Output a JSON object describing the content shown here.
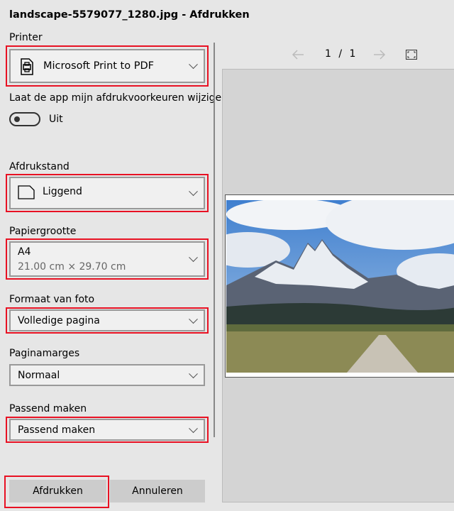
{
  "title": "landscape-5579077_1280.jpg - Afdrukken",
  "printer": {
    "label": "Printer",
    "value": "Microsoft Print to PDF",
    "icon": "printer-icon"
  },
  "app_prefs": {
    "label": "Laat de app mijn afdrukvoorkeuren wijzigen",
    "toggle_state": "Uit",
    "on": false
  },
  "orientation": {
    "label": "Afdrukstand",
    "value": "Liggend"
  },
  "paper_size": {
    "label": "Papiergrootte",
    "value": "A4",
    "dimensions": "21.00 cm × 29.70 cm"
  },
  "photo_size": {
    "label": "Formaat van foto",
    "value": "Volledige pagina"
  },
  "margins": {
    "label": "Paginamarges",
    "value": "Normaal"
  },
  "fit": {
    "label": "Passend maken",
    "value": "Passend maken"
  },
  "buttons": {
    "print": "Afdrukken",
    "cancel": "Annuleren"
  },
  "preview": {
    "current_page": "1",
    "separator": "/",
    "total_pages": "1"
  },
  "colors": {
    "highlight": "#e81123"
  }
}
